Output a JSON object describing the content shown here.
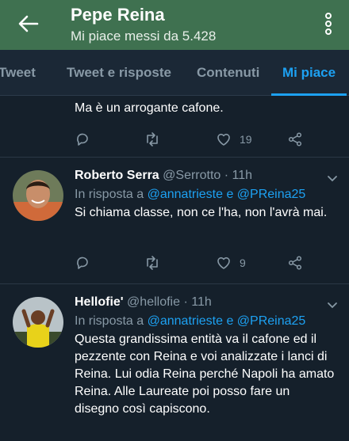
{
  "header": {
    "title": "Pepe Reina",
    "subtitle": "Mi piace messi da 5.428",
    "bg_color": "#3f7150"
  },
  "tabs": [
    {
      "label": "Tweet",
      "active": false
    },
    {
      "label": "Tweet e risposte",
      "active": false
    },
    {
      "label": "Contenuti",
      "active": false
    },
    {
      "label": "Mi piace",
      "active": true
    }
  ],
  "tweets": [
    {
      "text": "Ma è un arrogante cafone.",
      "likes": "19"
    },
    {
      "name": "Roberto Serra",
      "handle": "@Serrotto",
      "time": "· 11h",
      "reply_prefix": "In risposta a",
      "reply_to": "@annatrieste e @PReina25",
      "text": "Si chiama classe, non ce l'ha, non l'avrà mai.",
      "likes": "9"
    },
    {
      "name": "Hellofie'",
      "handle": "@hellofie",
      "time": "· 11h",
      "reply_prefix": "In risposta a",
      "reply_to": "@annatrieste e @PReina25",
      "text": "Questa grandissima entità va il cafone ed il pezzente con Reina e voi analizzate i lanci di Reina. Lui odia Reina perché Napoli ha amato Reina. Alle Laureate poi posso fare un disegno così capiscono."
    }
  ],
  "colors": {
    "background": "#15202b",
    "accent": "#1da1f2",
    "muted": "#8899a6"
  }
}
